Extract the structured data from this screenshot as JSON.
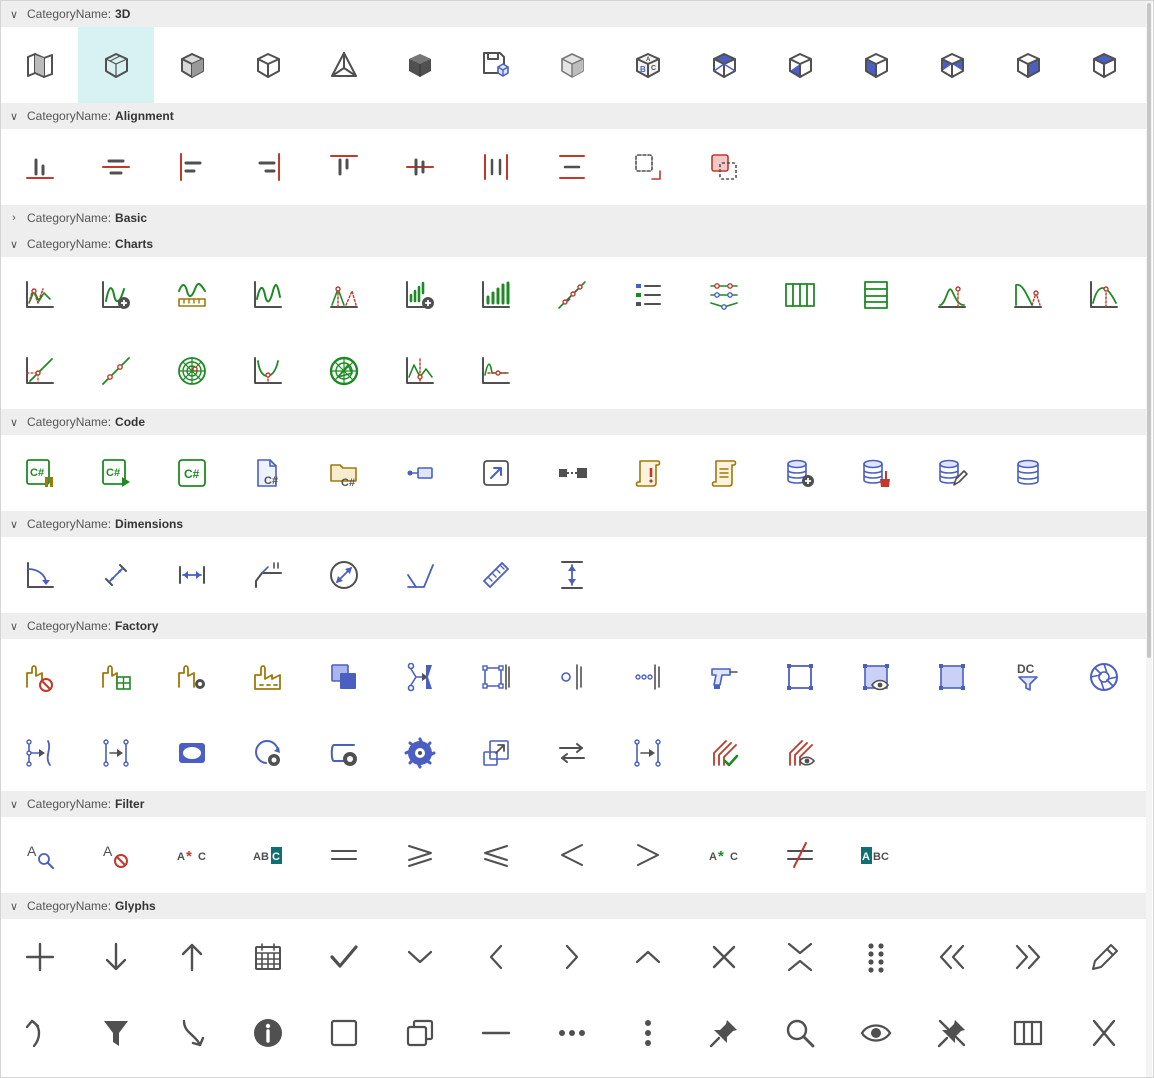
{
  "label_prefix": "CategoryName:",
  "colors": {
    "neutral": "#505050",
    "blue": "#4a5fc1",
    "red": "#c0392b",
    "green": "#1e8a24",
    "olive": "#a0780a",
    "teal": "#0f6f73"
  },
  "categories": [
    {
      "name": "3D",
      "expanded": true,
      "selected_index": 1,
      "icons": [
        "map-fold-icon",
        "cube-wireframe-icon",
        "cube-shaded-icon",
        "cube-outline-icon",
        "pyramid-icon",
        "cube-solid-icon",
        "save-3d-icon",
        "cube-gray-icon",
        "abc-cube-icon",
        "cube-view-top-icon",
        "cube-view-bottom-icon",
        "cube-view-front-icon",
        "cube-view-back-icon",
        "cube-view-right-icon",
        "cube-view-left-icon"
      ]
    },
    {
      "name": "Alignment",
      "expanded": true,
      "icons": [
        "align-bottom-icon",
        "align-vertical-center-icon",
        "align-left-icon",
        "align-right-icon",
        "align-top-icon",
        "align-horizontal-center-icon",
        "distribute-horizontal-icon",
        "distribute-vertical-icon",
        "selection-dashed-icon",
        "selection-copy-icon"
      ]
    },
    {
      "name": "Basic",
      "expanded": false,
      "icons": []
    },
    {
      "name": "Charts",
      "expanded": true,
      "icons": [
        "chart-peaks-icon",
        "chart-wave-add-icon",
        "chart-wave-ruler-icon",
        "chart-wave-icon",
        "chart-peak-dashed-icon",
        "chart-bars-add-icon",
        "chart-bars-icon",
        "chart-scatter-line-icon",
        "chart-legend-icon",
        "chart-points-connect-icon",
        "chart-columns-icon",
        "chart-rows-icon",
        "chart-curve-peak-icon",
        "chart-curve-fall-icon",
        "chart-curve-bell-icon",
        "chart-line-diag-icon",
        "chart-line-points-icon",
        "chart-radar-icon",
        "chart-curve-valley-icon",
        "chart-polar-icon",
        "chart-curve-mark-icon",
        "chart-curve-flat-icon"
      ]
    },
    {
      "name": "Code",
      "expanded": true,
      "icons": [
        "csharp-pause-icon",
        "csharp-run-icon",
        "csharp-icon",
        "csharp-file-icon",
        "csharp-folder-icon",
        "node-link-icon",
        "external-link-icon",
        "node-connect-icon",
        "script-error-icon",
        "script-icon",
        "database-add-icon",
        "database-clear-icon",
        "database-edit-icon",
        "database-icon"
      ]
    },
    {
      "name": "Dimensions",
      "expanded": true,
      "icons": [
        "dimension-angle-icon",
        "dimension-aligned-icon",
        "dimension-horizontal-icon",
        "dimension-ordinate-icon",
        "dimension-diameter-icon",
        "dimension-angular-icon",
        "ruler-icon",
        "dimension-vertical-icon"
      ]
    },
    {
      "name": "Factory",
      "expanded": true,
      "icons": [
        "factory-block-icon",
        "factory-grid-icon",
        "factory-settings-icon",
        "factory-icon",
        "layers-overlap-icon",
        "flow-split-icon",
        "bounds-tool-icon",
        "circle-tool-icon",
        "dots-tool-icon",
        "drill-icon",
        "frame-icon",
        "frame-view-icon",
        "frame-filled-icon",
        "dc-filter-icon",
        "aperture-icon",
        "flow-path-icon",
        "split-arrow-icon",
        "ellipse-filled-icon",
        "rotate-gear-icon",
        "shape-gear-icon",
        "saw-blade-icon",
        "resize-frame-icon",
        "swap-arrows-icon",
        "join-arrow-icon",
        "wires-check-icon",
        "wires-view-icon"
      ]
    },
    {
      "name": "Filter",
      "expanded": true,
      "icons": [
        "text-search-icon",
        "text-block-icon",
        "a-wildcard-c-icon",
        "abc-highlight-c-icon",
        "equals-icon",
        "greater-equal-icon",
        "less-equal-icon",
        "less-than-icon",
        "greater-than-icon",
        "a-wildcard-green-icon",
        "not-equal-icon",
        "abc-highlight-a-icon"
      ]
    },
    {
      "name": "Glyphs",
      "expanded": true,
      "icons": [
        "plus-icon",
        "arrow-down-icon",
        "arrow-up-icon",
        "calendar-icon",
        "check-icon",
        "chevron-down-icon",
        "chevron-left-icon",
        "chevron-right-icon",
        "chevron-up-icon",
        "close-icon",
        "collapse-icon",
        "drag-dots-icon",
        "double-chevron-left-icon",
        "double-chevron-right-icon",
        "pencil-icon",
        "arrow-turn-up-icon",
        "filter-icon",
        "arrow-turn-down-icon",
        "info-icon",
        "square-icon",
        "restore-icon",
        "minus-icon",
        "more-horizontal-icon",
        "more-vertical-icon",
        "pin-icon",
        "search-icon",
        "eye-icon",
        "unpin-icon",
        "columns-icon",
        "x-mark-icon"
      ]
    }
  ]
}
